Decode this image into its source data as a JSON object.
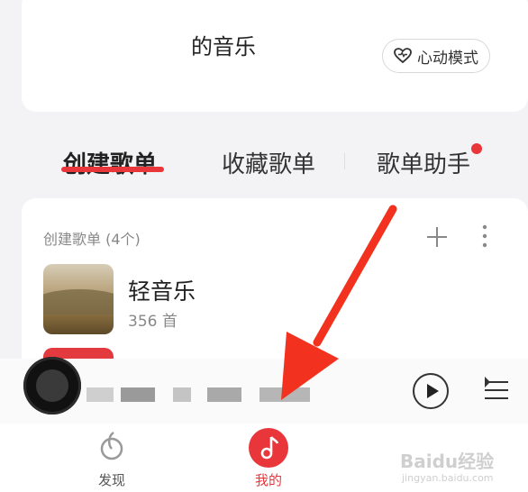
{
  "header": {
    "title": "的音乐",
    "mode_button": "心动模式"
  },
  "tabs": [
    {
      "label": "创建歌单",
      "active": true
    },
    {
      "label": "收藏歌单",
      "active": false
    },
    {
      "label": "歌单助手",
      "active": false,
      "badge": true
    }
  ],
  "created_section": {
    "title": "创建歌单 (4个)",
    "playlists": [
      {
        "name": "轻音乐",
        "count": "356 首"
      }
    ]
  },
  "player": {
    "track_text": ""
  },
  "bottom_nav": [
    {
      "label": "发现",
      "icon": "discover-icon",
      "active": false
    },
    {
      "label": "我的",
      "icon": "music-note-icon",
      "active": true
    }
  ],
  "watermark": {
    "brand": "Baidu经验",
    "url": "jingyan.baidu.com"
  },
  "colors": {
    "accent": "#e8363b",
    "background": "#f3f3f5"
  }
}
